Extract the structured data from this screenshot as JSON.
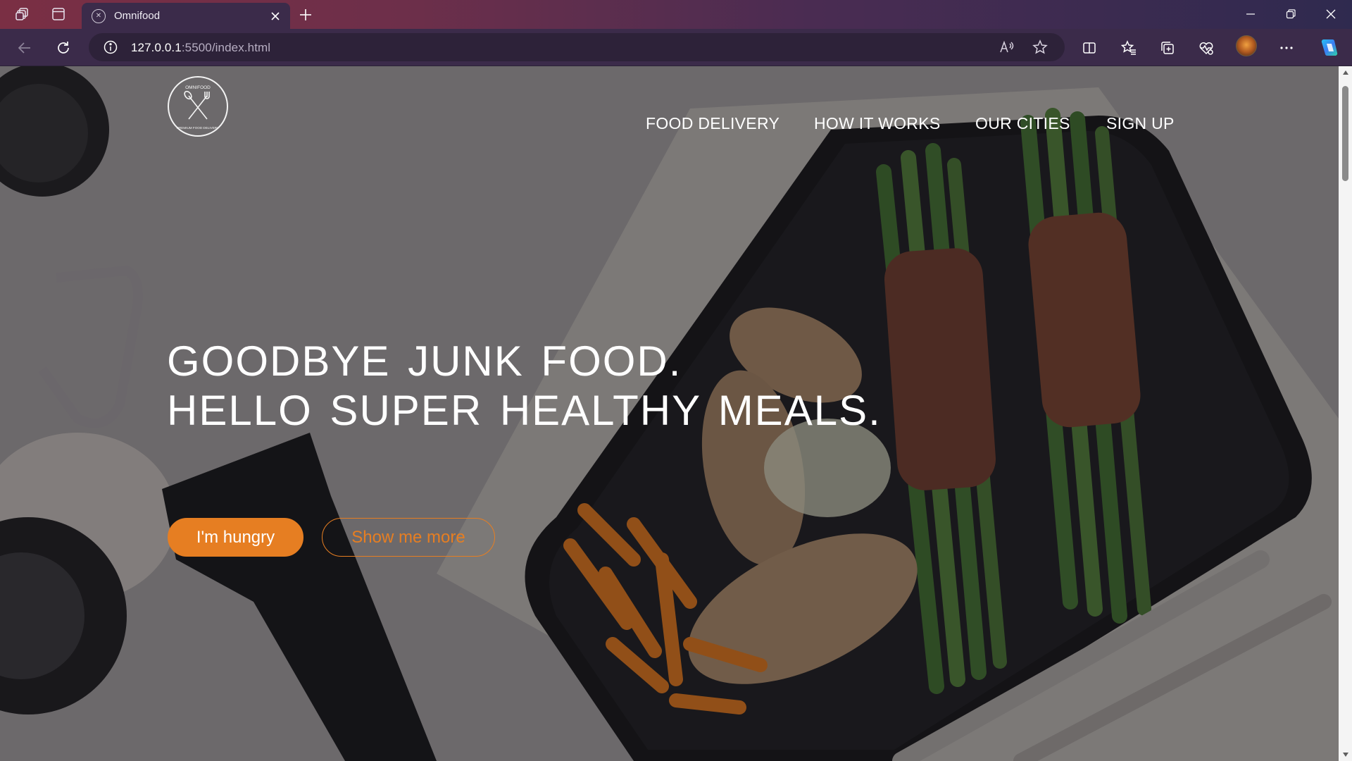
{
  "browser": {
    "tab": {
      "title": "Omnifood"
    },
    "url": {
      "host": "127.0.0.1",
      "rest": ":5500/index.html"
    }
  },
  "page": {
    "logo": {
      "top_text": "OMNIFOOD",
      "bottom_text": "PREMIUM FOOD DELIVERY"
    },
    "nav": [
      "FOOD DELIVERY",
      "HOW IT WORKS",
      "OUR CITIES",
      "SIGN UP"
    ],
    "hero": {
      "line1": "GOODBYE JUNK FOOD.",
      "line2": "HELLO SUPER HEALTHY MEALS.",
      "primary_button": "I'm hungry",
      "secondary_button": "Show me more"
    },
    "colors": {
      "accent": "#e67e22",
      "hero_text": "#ffffff"
    }
  },
  "icons": {
    "tab_actions": "tab-actions-icon",
    "vertical_tabs": "vertical-tabs-icon",
    "site_info": "info-icon",
    "read_aloud": "read-aloud-icon",
    "favorite": "star-icon",
    "split_screen": "split-screen-icon",
    "favorites": "favorites-icon",
    "collections": "collections-icon",
    "browser_essentials": "heart-pulse-icon",
    "settings_more": "more-icon",
    "copilot": "copilot-icon"
  }
}
